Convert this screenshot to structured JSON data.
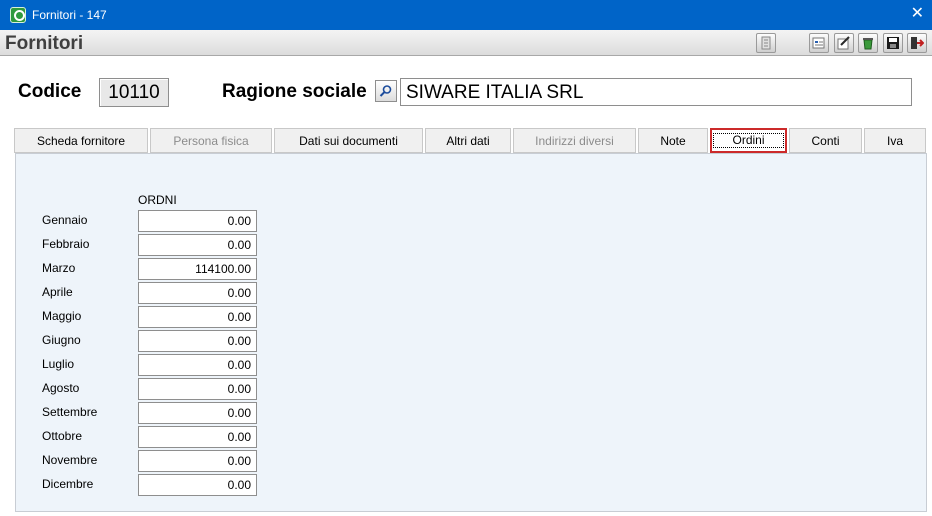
{
  "window": {
    "title": "Fornitori - 147",
    "close_glyph": "✕"
  },
  "header": {
    "form_title": "Fornitori"
  },
  "toolbar": {
    "icons": [
      "document-icon",
      "report-icon",
      "edit-icon",
      "recycle-icon",
      "save-icon",
      "exit-icon"
    ]
  },
  "form": {
    "codice_label": "Codice",
    "codice_value": "10110",
    "ragione_label": "Ragione sociale",
    "ragione_value": "SIWARE ITALIA SRL"
  },
  "tabs": [
    {
      "label": "Scheda fornitore",
      "state": "normal"
    },
    {
      "label": "Persona fisica",
      "state": "disabled"
    },
    {
      "label": "Dati sui documenti",
      "state": "normal"
    },
    {
      "label": "Altri dati",
      "state": "normal"
    },
    {
      "label": "Indirizzi diversi",
      "state": "disabled"
    },
    {
      "label": "Note",
      "state": "normal"
    },
    {
      "label": "Ordini",
      "state": "active"
    },
    {
      "label": "Conti",
      "state": "normal"
    },
    {
      "label": "Iva",
      "state": "normal"
    }
  ],
  "ordini": {
    "column_header": "ORDNI",
    "months": [
      {
        "label": "Gennaio",
        "value": "0.00"
      },
      {
        "label": "Febbraio",
        "value": "0.00"
      },
      {
        "label": "Marzo",
        "value": "114100.00"
      },
      {
        "label": "Aprile",
        "value": "0.00"
      },
      {
        "label": "Maggio",
        "value": "0.00"
      },
      {
        "label": "Giugno",
        "value": "0.00"
      },
      {
        "label": "Luglio",
        "value": "0.00"
      },
      {
        "label": "Agosto",
        "value": "0.00"
      },
      {
        "label": "Settembre",
        "value": "0.00"
      },
      {
        "label": "Ottobre",
        "value": "0.00"
      },
      {
        "label": "Novembre",
        "value": "0.00"
      },
      {
        "label": "Dicembre",
        "value": "0.00"
      }
    ]
  },
  "colors": {
    "titlebar": "#0064c8",
    "active_tab_border": "#cc2a2a",
    "panel": "#eef4fa"
  }
}
